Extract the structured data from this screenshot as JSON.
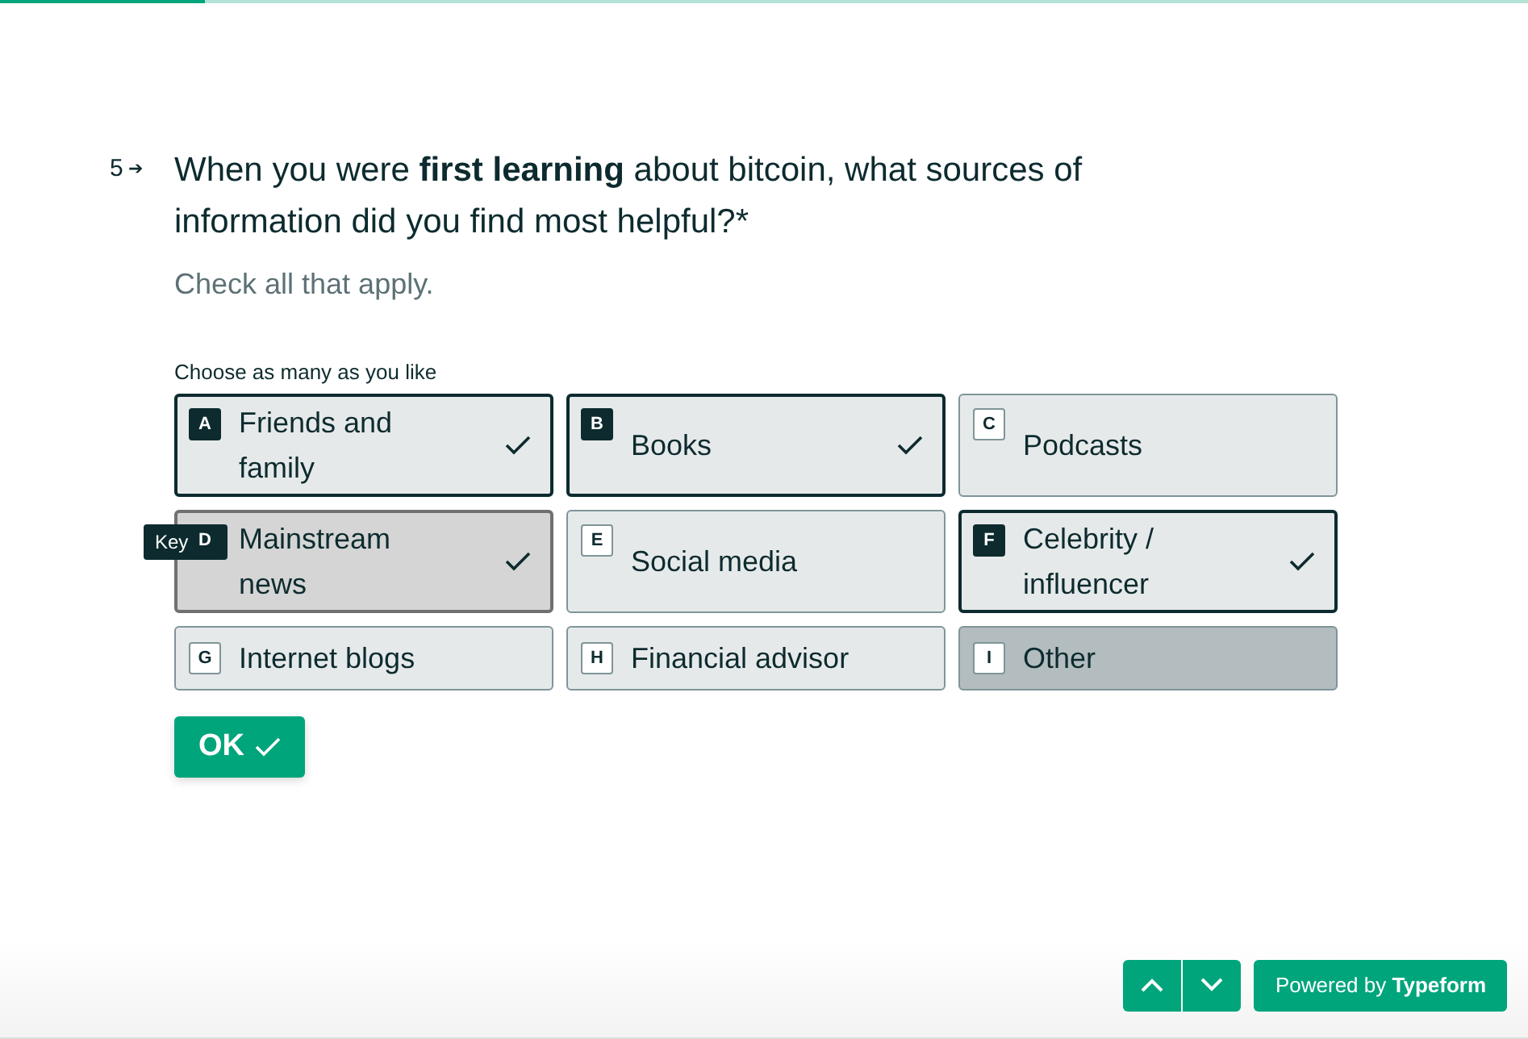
{
  "progress": {
    "level": 0.134
  },
  "question": {
    "number": "5",
    "arrow": "➔",
    "text": "When you were **first learning** about bitcoin, what sources of information did you find most helpful?*",
    "description": "Check all that apply.",
    "hint": "Choose as many as you like"
  },
  "options": [
    {
      "key": "A",
      "label": "Friends and family",
      "selected": true,
      "hovered": false
    },
    {
      "key": "B",
      "label": "Books",
      "selected": true,
      "hovered": false
    },
    {
      "key": "C",
      "label": "Podcasts",
      "selected": false,
      "hovered": false
    },
    {
      "key": "D",
      "label": "Mainstream news",
      "selected": true,
      "hovered": true,
      "tooltip": "Key"
    },
    {
      "key": "E",
      "label": "Social media",
      "selected": false,
      "hovered": false
    },
    {
      "key": "F",
      "label": "Celebrity / influencer",
      "selected": true,
      "hovered": false
    },
    {
      "key": "G",
      "label": "Internet blogs",
      "selected": false,
      "hovered": false
    },
    {
      "key": "H",
      "label": "Financial advisor",
      "selected": false,
      "hovered": false
    },
    {
      "key": "I",
      "label": "Other",
      "selected": false,
      "hovered": true
    }
  ],
  "ok_button": "OK",
  "footer": {
    "powered_by": "Powered by **Typeform**"
  }
}
